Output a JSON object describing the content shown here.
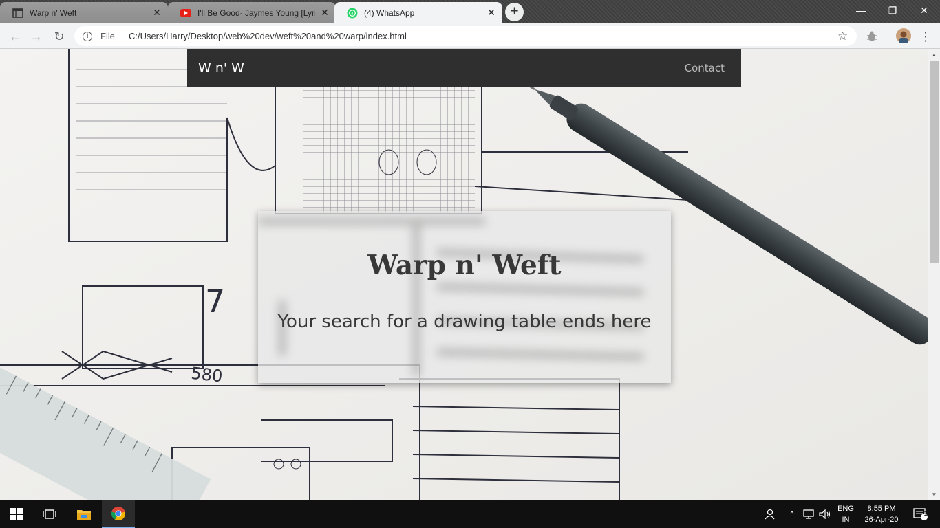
{
  "browser": {
    "tabs": [
      {
        "title": "Warp n' Weft",
        "active": false,
        "icon": "page-icon"
      },
      {
        "title": "I'll Be Good- Jaymes Young [Lyric",
        "active": false,
        "icon": "youtube-icon"
      },
      {
        "title": "(4) WhatsApp",
        "active": true,
        "icon": "whatsapp-icon"
      }
    ],
    "tab_close": "✕",
    "new_tab": "+",
    "window": {
      "minimize": "—",
      "restore": "❐",
      "close": "✕"
    },
    "address": {
      "scheme_label": "File",
      "url": "C:/Users/Harry/Desktop/web%20dev/weft%20and%20warp/index.html"
    },
    "nav": {
      "back": "←",
      "forward": "→",
      "reload": "↻",
      "star": "☆",
      "info": "i",
      "menu": "⋮"
    }
  },
  "page": {
    "brand": "W n' W",
    "nav_link": "Contact",
    "hero_title": "Warp n' Weft",
    "hero_subtitle": "Your search for a drawing table ends here"
  },
  "taskbar": {
    "language": "ENG",
    "region": "IN",
    "time": "8:55 PM",
    "date": "26-Apr-20",
    "notifications": "1"
  },
  "colors": {
    "site_nav_bg": "#2f2f2f",
    "hero_text": "#383838",
    "chrome_toolbar": "#f1f3f4"
  }
}
